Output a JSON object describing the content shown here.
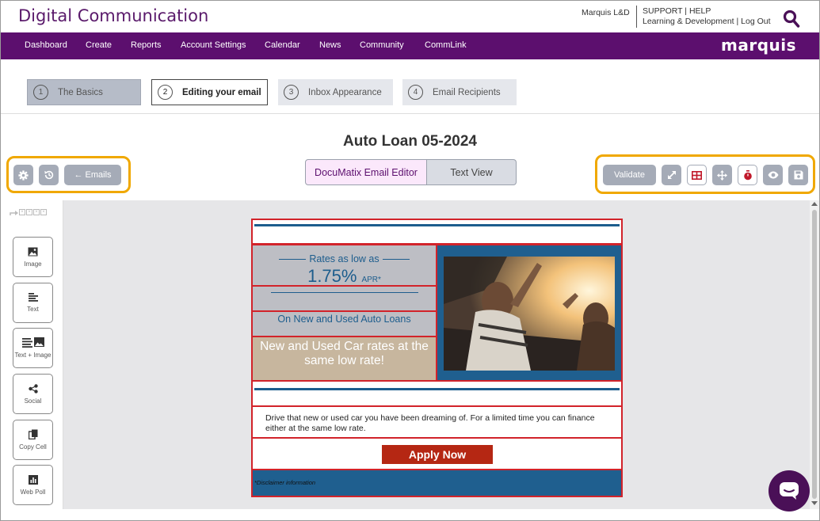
{
  "header": {
    "title": "Digital Communication",
    "user": "Marquis L&D",
    "support_links": "SUPPORT | HELP",
    "account_links": "Learning & Development | Log Out",
    "search_icon": "search-icon"
  },
  "nav": {
    "items": [
      "Dashboard",
      "Create",
      "Reports",
      "Account Settings",
      "Calendar",
      "News",
      "Community",
      "CommLink"
    ],
    "brand": "marquis",
    "bg_color": "#5c0f6e"
  },
  "steps": [
    {
      "num": "1",
      "label": "The Basics"
    },
    {
      "num": "2",
      "label": "Editing your email"
    },
    {
      "num": "3",
      "label": "Inbox Appearance"
    },
    {
      "num": "4",
      "label": "Email Recipients"
    }
  ],
  "email_title": "Auto Loan 05-2024",
  "toolbar_left": {
    "settings_icon": "gear-icon",
    "history_icon": "history-icon",
    "emails_label": "← Emails"
  },
  "editor_toggle": {
    "documatix": "DocuMatix Email Editor",
    "text_view": "Text View"
  },
  "toolbar_right": {
    "validate": "Validate",
    "icons": [
      "expand-icon",
      "grid-icon",
      "move-icon",
      "timer-icon",
      "eye-icon",
      "save-icon"
    ]
  },
  "sidebar": {
    "tools": [
      "Image",
      "Text",
      "Text + Image",
      "Social",
      "Copy Cell",
      "Web Poll"
    ]
  },
  "email": {
    "rates_as_low_as": "Rates as low as",
    "rate": "1.75%",
    "apr": "APR*",
    "on_new_used": "On New and Used Auto Loans",
    "new_used_rates": "New and Used Car rates at the same low rate!",
    "body": "Drive that new or used car you have been dreaming of.  For a limited time you can finance either at the same low rate.",
    "apply_now": "Apply Now",
    "disclaimer": "*Disclaimer information",
    "accent_color": "#1d5d8d",
    "cta_color": "#b52713",
    "cell_border_color": "#d2232a"
  },
  "highlight_color": "#f0a800"
}
